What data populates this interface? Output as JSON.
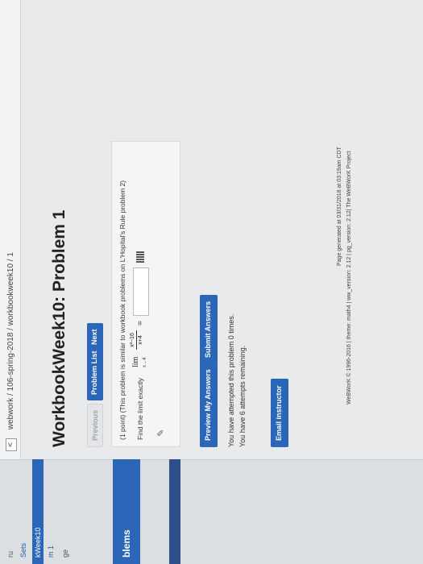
{
  "breadcrumb": "webwork / 106-spring-2018 / workbookweek10 / 1",
  "sidebar": {
    "items": [
      "ru",
      "Sets",
      "kWeek10",
      "m 1",
      "ge"
    ],
    "active": "blems"
  },
  "title": "WorkbookWeek10: Problem 1",
  "nav": {
    "previous": "Previous",
    "problem_list": "Problem List",
    "next": "Next"
  },
  "problem": {
    "intro": "(1 point) (This problem is similar to workbook problems on L'Hopital's Rule problem 2)",
    "find": "Find the limit exactly",
    "lim": "lim",
    "lim_sub": "x→4",
    "numerator": "x²−16",
    "denominator": "x+4",
    "equals": "="
  },
  "actions": {
    "preview": "Preview My Answers",
    "submit": "Submit Answers"
  },
  "status": {
    "attempted": "You have attempted this problem 0 times.",
    "remaining": "You have 6 attempts remaining."
  },
  "email": "Email instructor",
  "footer": {
    "generated": "Page generated at 03/31/2018 at 03:19am CDT",
    "copyright": "WeBWorK © 1996-2016 | theme: math4 | ww_version: 2.12 | pg_version: 2.12| The WeBWorK Project"
  }
}
